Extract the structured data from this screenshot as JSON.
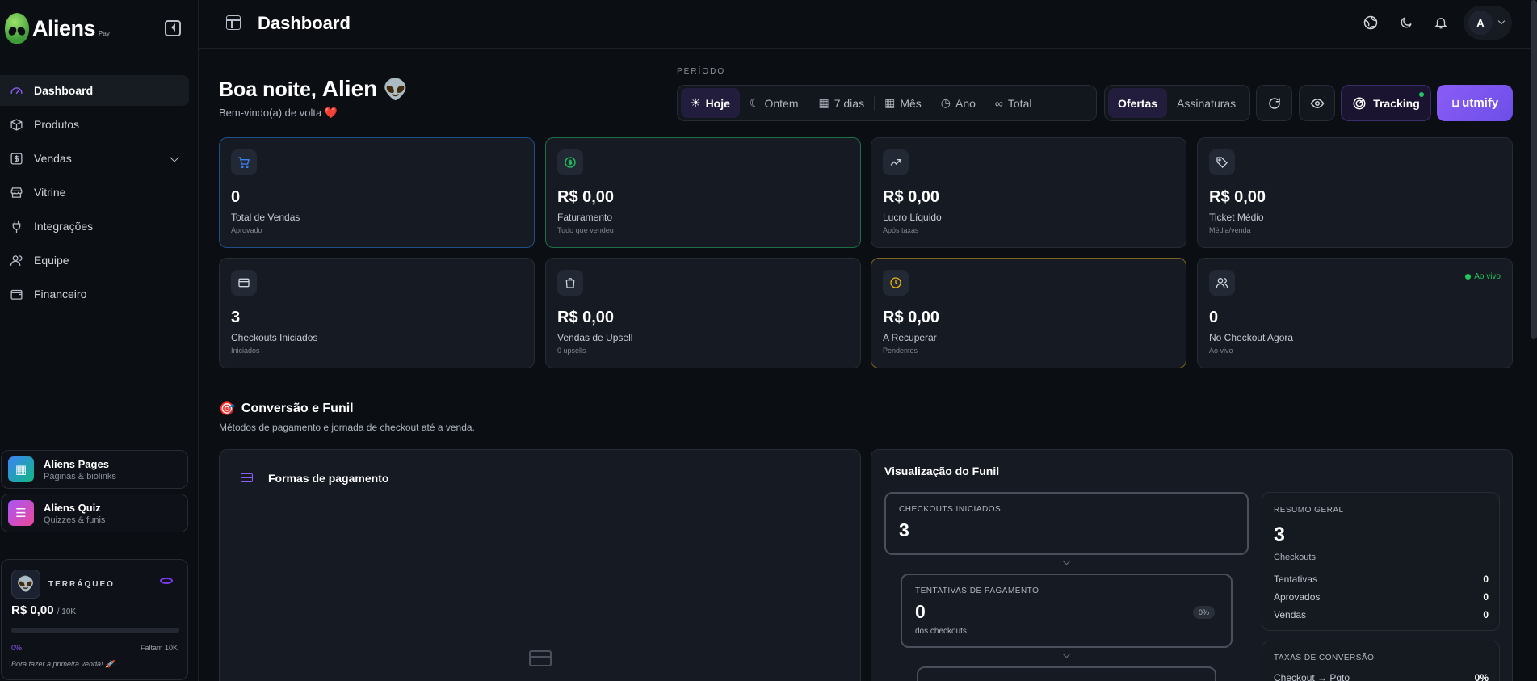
{
  "brand": {
    "name": "Aliens",
    "sub": "Pay"
  },
  "sidebar": {
    "items": [
      {
        "label": "Dashboard",
        "icon": "gauge-icon",
        "active": true
      },
      {
        "label": "Produtos",
        "icon": "package-icon"
      },
      {
        "label": "Vendas",
        "icon": "dollar-icon",
        "expandable": true
      },
      {
        "label": "Vitrine",
        "icon": "store-icon"
      },
      {
        "label": "Integrações",
        "icon": "plug-icon"
      },
      {
        "label": "Equipe",
        "icon": "users-icon"
      },
      {
        "label": "Financeiro",
        "icon": "wallet-icon"
      }
    ],
    "promos": [
      {
        "title": "Aliens Pages",
        "sub": "Páginas & biolinks"
      },
      {
        "title": "Aliens Quiz",
        "sub": "Quizzes & funis"
      }
    ],
    "level": {
      "name": "TERRÁQUEO",
      "amount": "R$ 0,00",
      "goal": "/ 10K",
      "progress_pct": 0,
      "pct_label": "0%",
      "remaining": "Faltam 10K",
      "message": "Bora fazer a primeira venda! 🚀"
    }
  },
  "header": {
    "title": "Dashboard",
    "avatar_initial": "A"
  },
  "greeting": {
    "prefix": "Boa noite,",
    "name": "Alien",
    "emoji": "👽",
    "sub": "Bem-vindo(a) de volta ❤️"
  },
  "period": {
    "label": "PERÍODO",
    "options": [
      "Hoje",
      "Ontem",
      "7 dias",
      "Mês",
      "Ano",
      "Total"
    ],
    "selected": "Hoje"
  },
  "segment": {
    "options": [
      "Ofertas",
      "Assinaturas"
    ],
    "selected": "Ofertas"
  },
  "actions": {
    "tracking": "Tracking",
    "utmify": "utmify"
  },
  "stats": [
    {
      "value": "0",
      "label": "Total de Vendas",
      "sub": "Aprovado",
      "accent": "#3b82f6"
    },
    {
      "value": "R$ 0,00",
      "label": "Faturamento",
      "sub": "Tudo que vendeu",
      "accent": "#22c55e"
    },
    {
      "value": "R$ 0,00",
      "label": "Lucro Líquido",
      "sub": "Após taxas",
      "accent": "#cfd4db"
    },
    {
      "value": "R$ 0,00",
      "label": "Ticket Médio",
      "sub": "Média/venda",
      "accent": "#cfd4db"
    },
    {
      "value": "3",
      "label": "Checkouts Iniciados",
      "sub": "Iniciados",
      "accent": "#cfd4db"
    },
    {
      "value": "R$ 0,00",
      "label": "Vendas de Upsell",
      "sub": "0 upsells",
      "accent": "#cfd4db"
    },
    {
      "value": "R$ 0,00",
      "label": "A Recuperar",
      "sub": "Pendentes",
      "accent": "#eab308"
    },
    {
      "value": "0",
      "label": "No Checkout Agora",
      "sub": "Ao vivo",
      "accent": "#cfd4db",
      "live": "Ao vivo"
    }
  ],
  "conversion": {
    "title": "Conversão e Funil",
    "sub": "Métodos de pagamento e jornada de checkout até a venda.",
    "payments_title": "Formas de pagamento",
    "funnel_title": "Visualização do Funil",
    "funnel": [
      {
        "label": "CHECKOUTS INICIADOS",
        "value": "3"
      },
      {
        "label": "TENTATIVAS DE PAGAMENTO",
        "value": "0",
        "sub": "dos checkouts",
        "pct": "0%"
      }
    ],
    "summary": {
      "title": "RESUMO GERAL",
      "value": "3",
      "label": "Checkouts",
      "rows": [
        {
          "label": "Tentativas",
          "value": "0"
        },
        {
          "label": "Aprovados",
          "value": "0"
        },
        {
          "label": "Vendas",
          "value": "0"
        }
      ]
    },
    "rates": {
      "title": "TAXAS DE CONVERSÃO",
      "row_label": "Checkout → Pgto",
      "row_value": "0%"
    }
  }
}
